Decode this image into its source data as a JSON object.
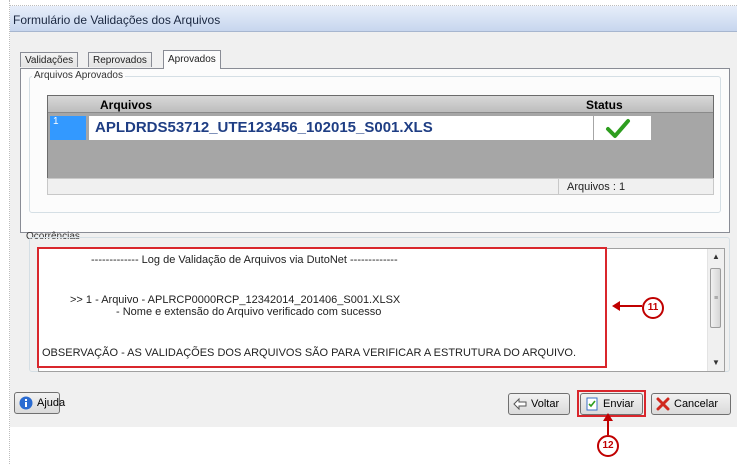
{
  "window": {
    "title": "Formulário de Validações dos Arquivos"
  },
  "tabs": [
    "Validações",
    "Reprovados",
    "Aprovados"
  ],
  "approved_group": {
    "label": "Arquivos Aprovados",
    "columns": {
      "files": "Arquivos",
      "status": "Status"
    },
    "rows": [
      {
        "num": "1",
        "file": "APLDRDS53712_UTE123456_102015_S001.XLS",
        "status_icon": "green-check"
      }
    ],
    "footer_count": "Arquivos : 1"
  },
  "occurrences": {
    "label": "Ocorrências",
    "log_header": "------------- Log de Validação de Arquivos via DutoNet -------------",
    "line1": ">> 1 - Arquivo - APLRCP0000RCP_12342014_201406_S001.XLSX",
    "line2": "- Nome e extensão do Arquivo verificado com sucesso",
    "observation": "OBSERVAÇÃO - AS VALIDAÇÕES DOS ARQUIVOS SÃO PARA VERIFICAR A ESTRUTURA DO ARQUIVO."
  },
  "buttons": {
    "help": "Ajuda",
    "back": "Voltar",
    "send": "Enviar",
    "cancel": "Cancelar"
  },
  "callouts": {
    "log": "11",
    "send": "12"
  },
  "colors": {
    "highlight": "#d9262c",
    "selection": "#3399ff",
    "file_text": "#1f3e84",
    "check": "#2e9e1f"
  }
}
